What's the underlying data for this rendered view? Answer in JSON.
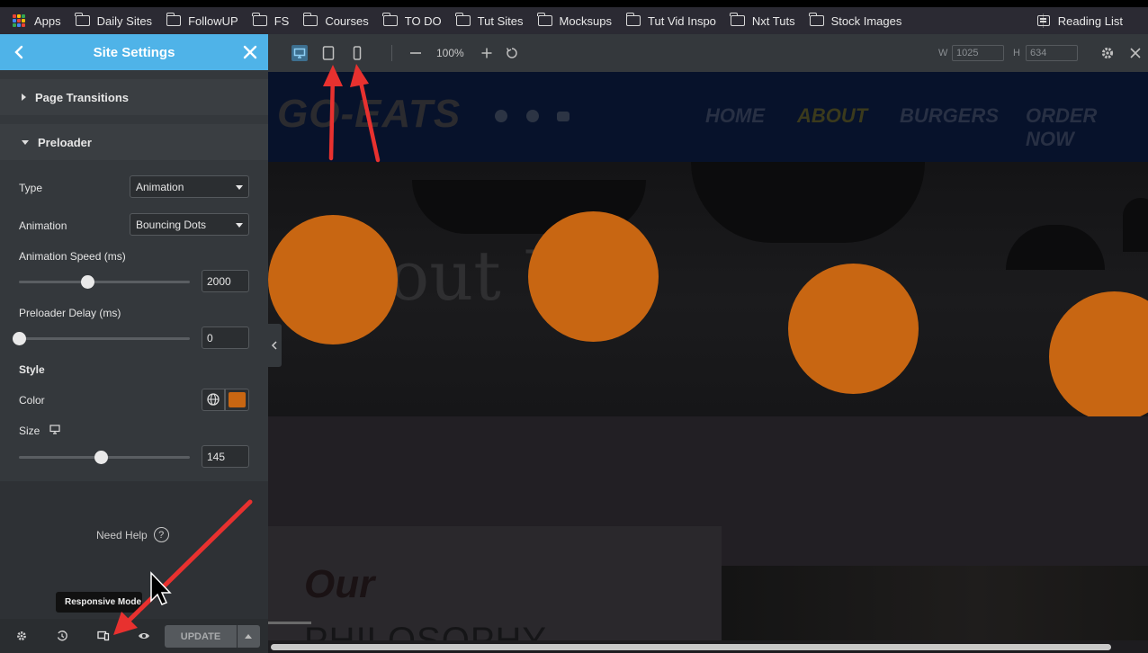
{
  "bookmarks_bar": {
    "items": [
      {
        "label": "Apps",
        "icon": "apps-grid-icon"
      },
      {
        "label": "Daily Sites",
        "icon": "folder-icon"
      },
      {
        "label": "FollowUP",
        "icon": "folder-icon"
      },
      {
        "label": "FS",
        "icon": "folder-icon"
      },
      {
        "label": "Courses",
        "icon": "folder-icon"
      },
      {
        "label": "TO DO",
        "icon": "folder-icon"
      },
      {
        "label": "Tut Sites",
        "icon": "folder-icon"
      },
      {
        "label": "Mocksups",
        "icon": "folder-icon"
      },
      {
        "label": "Tut Vid Inspo",
        "icon": "folder-icon"
      },
      {
        "label": "Nxt Tuts",
        "icon": "folder-icon"
      },
      {
        "label": "Stock Images",
        "icon": "folder-icon"
      }
    ],
    "reading_list": "Reading List"
  },
  "panel": {
    "title": "Site Settings",
    "header_color": "#4fb3e8",
    "sections": {
      "page_transitions": "Page Transitions",
      "preloader": "Preloader"
    },
    "controls": {
      "type_label": "Type",
      "type_value": "Animation",
      "animation_label": "Animation",
      "animation_value": "Bouncing Dots",
      "speed_label": "Animation Speed (ms)",
      "speed_value": "2000",
      "speed_fraction": 0.4,
      "delay_label": "Preloader Delay (ms)",
      "delay_value": "0",
      "delay_fraction": 0.0,
      "style_heading": "Style",
      "color_label": "Color",
      "color_value": "#c86612",
      "size_label": "Size",
      "size_value": "145",
      "size_fraction": 0.48
    },
    "need_help": "Need Help",
    "help_glyph": "?",
    "tooltip": "Responsive Mode",
    "update_button": "UPDATE"
  },
  "responsive_bar": {
    "zoom": "100%",
    "width_label": "W",
    "width_value": "1025",
    "height_label": "H",
    "height_value": "634"
  },
  "preview": {
    "logo": "GO-EATS",
    "nav": [
      "HOME",
      "ABOUT",
      "BURGERS",
      "ORDER NOW"
    ],
    "hero_text": "About U",
    "our": "Our",
    "philosophy": "PHILOSOPHY",
    "dot_color": "#c86612"
  },
  "annotations": {
    "arrow_color": "#e8312f"
  }
}
